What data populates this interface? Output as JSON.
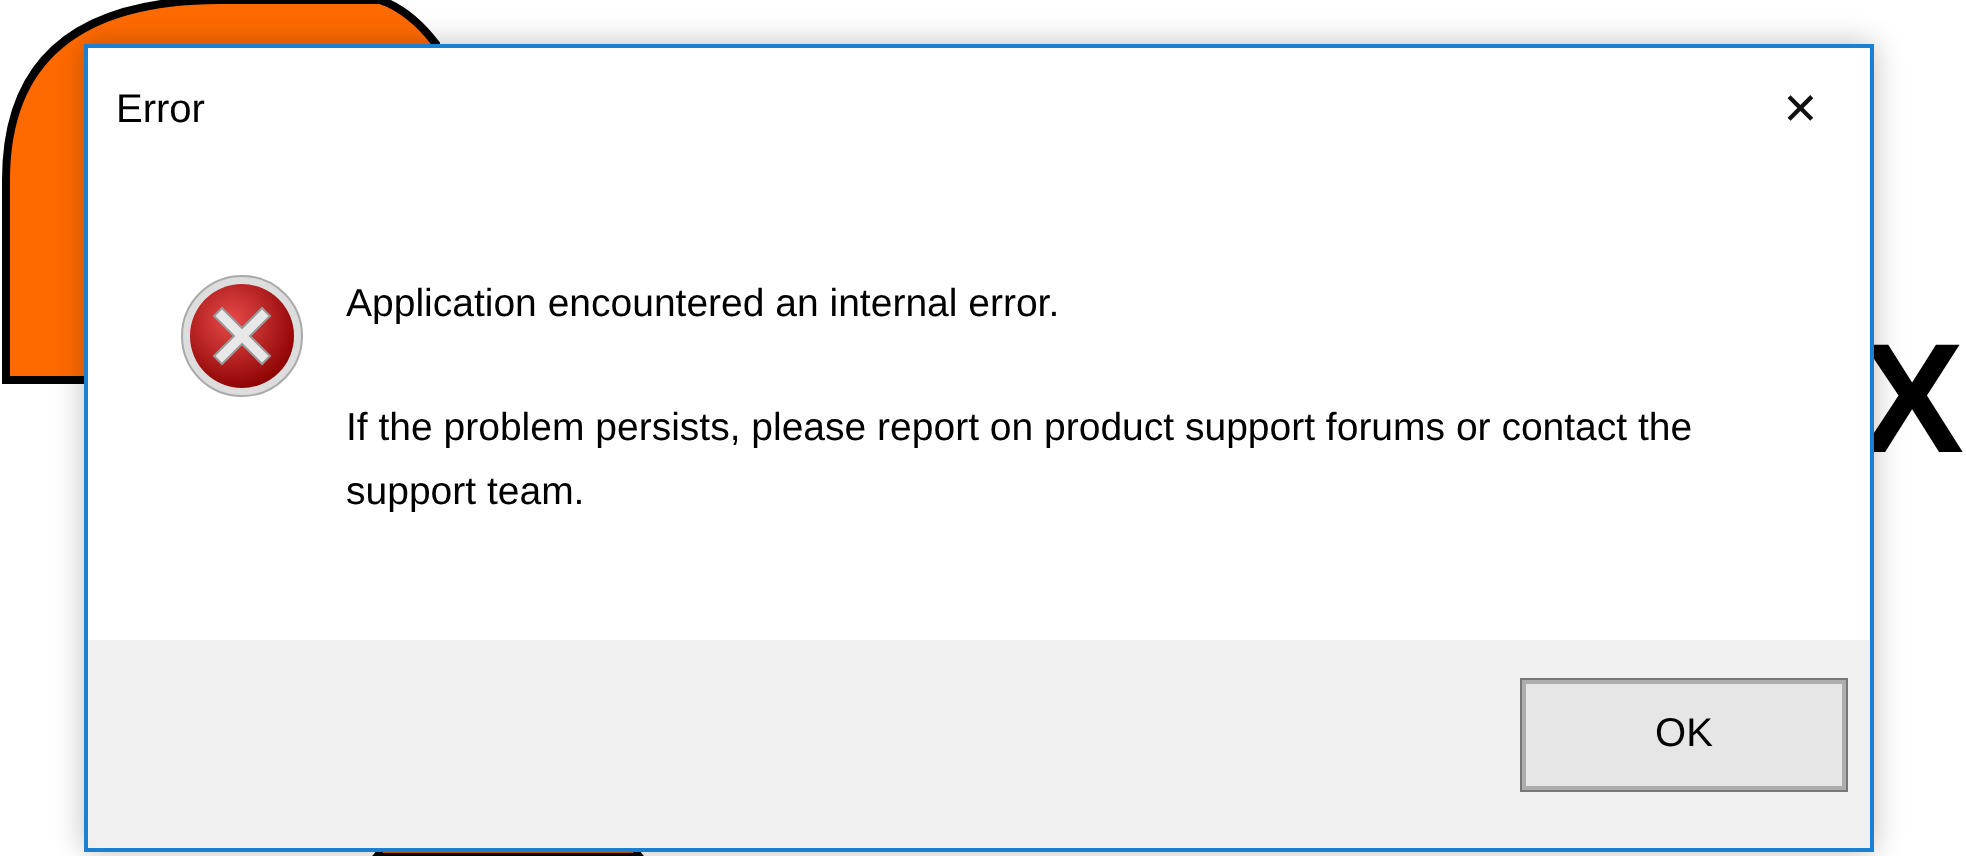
{
  "background": {
    "text": "X"
  },
  "dialog": {
    "title": "Error",
    "close": "✕",
    "message": [
      "Application encountered an internal error.",
      "If the problem persists, please report on product support forums or contact the support team."
    ],
    "buttons": [
      {
        "label": "OK",
        "default": false
      }
    ]
  }
}
